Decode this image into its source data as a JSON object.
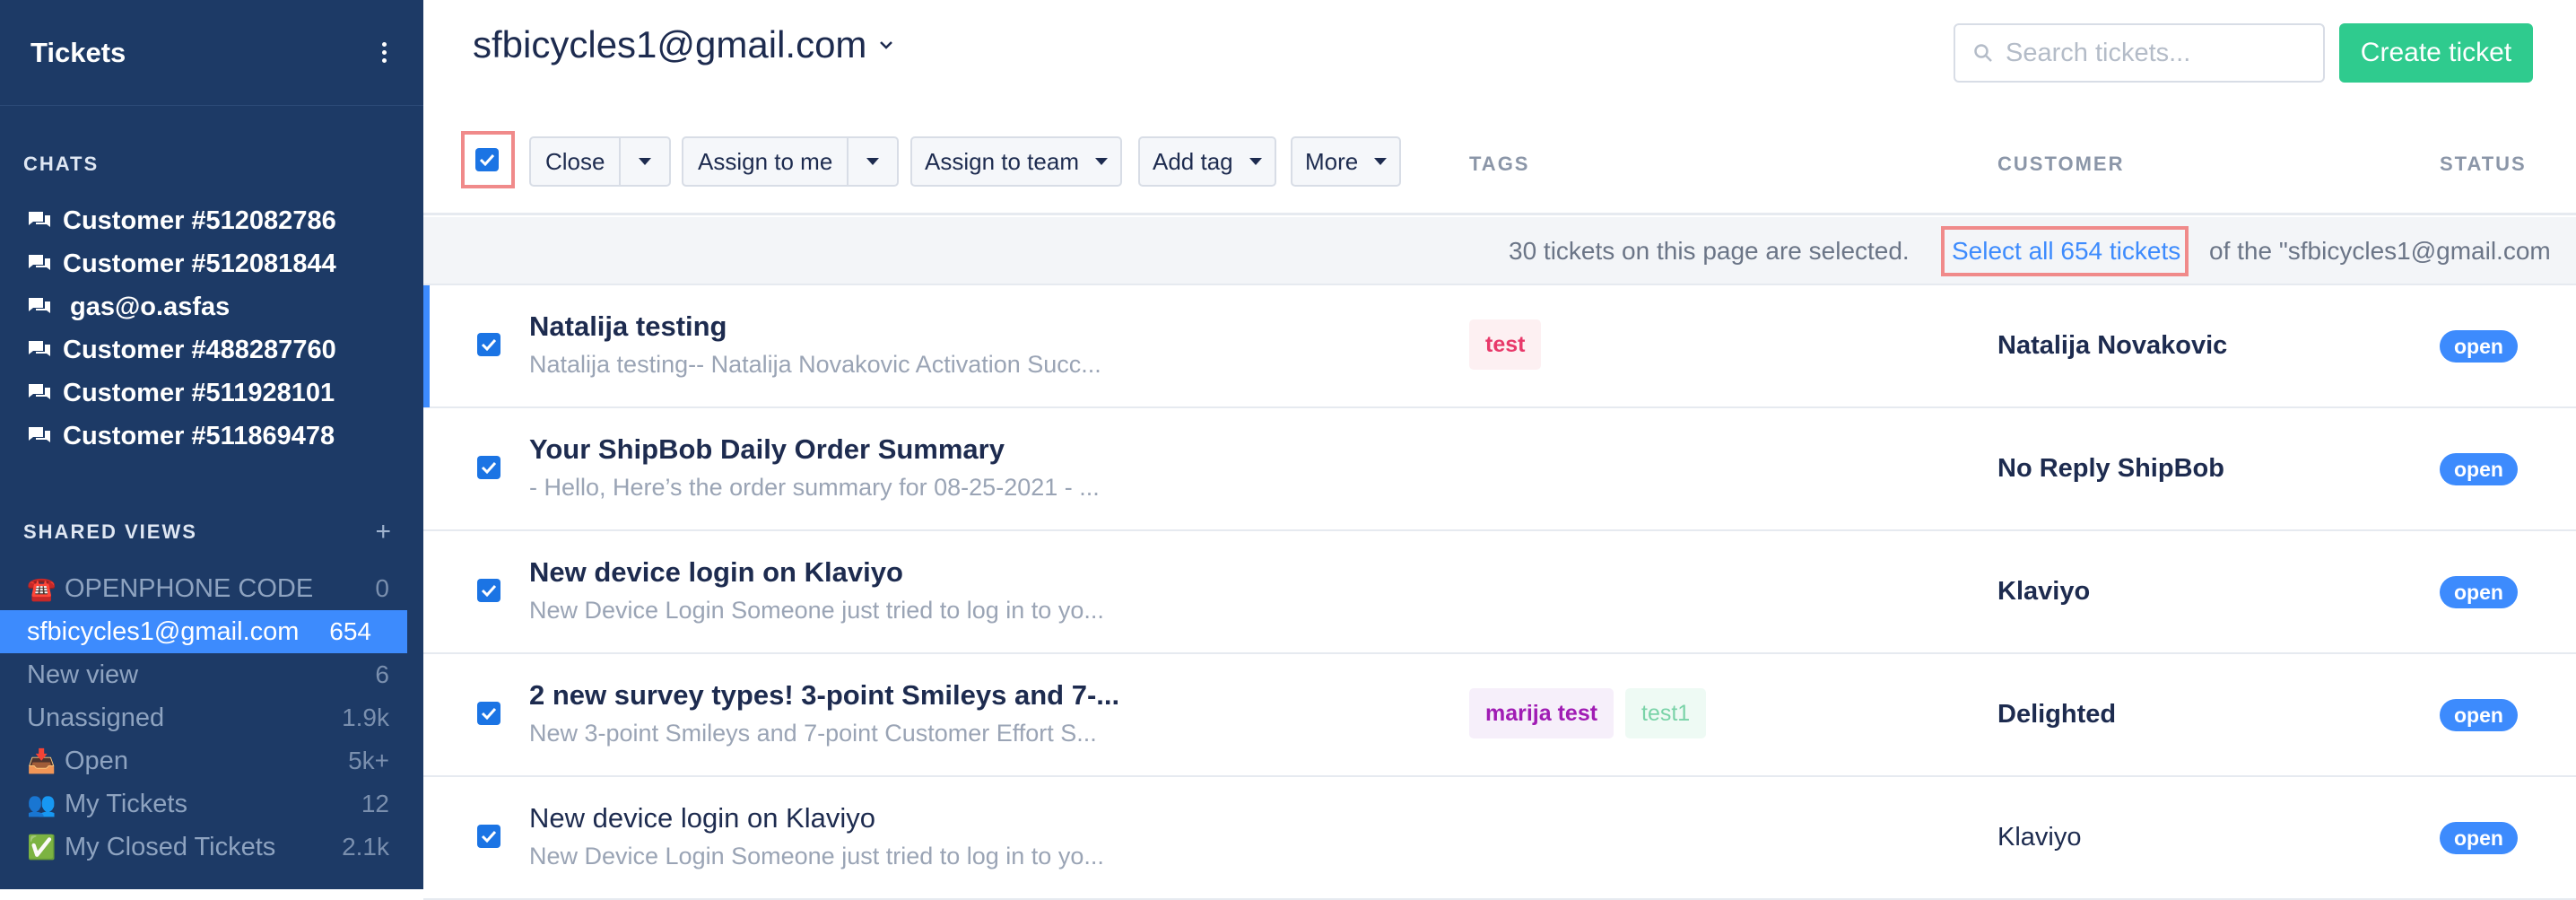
{
  "sidebar": {
    "title": "Tickets",
    "chats_label": "CHATS",
    "chats": [
      {
        "label": "Customer #512082786"
      },
      {
        "label": "Customer #512081844"
      },
      {
        "label": " gas@o.asfas"
      },
      {
        "label": "Customer #488287760"
      },
      {
        "label": "Customer #511928101"
      },
      {
        "label": "Customer #511869478"
      }
    ],
    "shared_label": "SHARED VIEWS",
    "plus": "+",
    "views": [
      {
        "emoji": "☎️",
        "label": "OPENPHONE CODE",
        "count": "0"
      },
      {
        "emoji": "",
        "label": "sfbicycles1@gmail.com",
        "count": "654"
      },
      {
        "emoji": "",
        "label": "New view",
        "count": "6"
      },
      {
        "emoji": "",
        "label": "Unassigned",
        "count": "1.9k"
      },
      {
        "emoji": "📥",
        "label": "Open",
        "count": "5k+"
      },
      {
        "emoji": "👥",
        "label": "My Tickets",
        "count": "12"
      },
      {
        "emoji": "✅",
        "label": "My Closed Tickets",
        "count": "2.1k"
      }
    ]
  },
  "header": {
    "account": "sfbicycles1@gmail.com",
    "search_placeholder": "Search tickets...",
    "create_label": "Create ticket"
  },
  "toolbar": {
    "close": "Close",
    "assign_me": "Assign to me",
    "assign_team": "Assign to team",
    "add_tag": "Add tag",
    "more": "More"
  },
  "columns": {
    "tags": "TAGS",
    "customer": "CUSTOMER",
    "status": "STATUS"
  },
  "selection": {
    "text": "30 tickets on this page are selected.",
    "link": "Select all 654 tickets",
    "suffix": "of the \"sfbicycles1@gmail.com"
  },
  "tickets": [
    {
      "subject": "Natalija testing",
      "snippet": "Natalija testing-- Natalija Novakovic Activation Succ...",
      "tags": [
        "test"
      ],
      "customer": "Natalija Novakovic",
      "status": "open"
    },
    {
      "subject": "Your ShipBob Daily Order Summary",
      "snippet": "- Hello, Here’s the order summary for 08-25-2021 - ...",
      "tags": [],
      "customer": "No Reply ShipBob",
      "status": "open"
    },
    {
      "subject": "New device login on Klaviyo",
      "snippet": "New Device Login Someone just tried to log in to yo...",
      "tags": [],
      "customer": "Klaviyo",
      "status": "open"
    },
    {
      "subject": "2 new survey types! 3-point Smileys and 7-...",
      "snippet": "New 3-point Smileys and 7-point Customer Effort S...",
      "tags": [
        "marija test",
        "test1"
      ],
      "customer": "Delighted",
      "status": "open"
    },
    {
      "subject": "New device login on Klaviyo",
      "snippet": "New Device Login Someone just tried to log in to yo...",
      "tags": [],
      "customer": "Klaviyo",
      "status": "open"
    }
  ]
}
